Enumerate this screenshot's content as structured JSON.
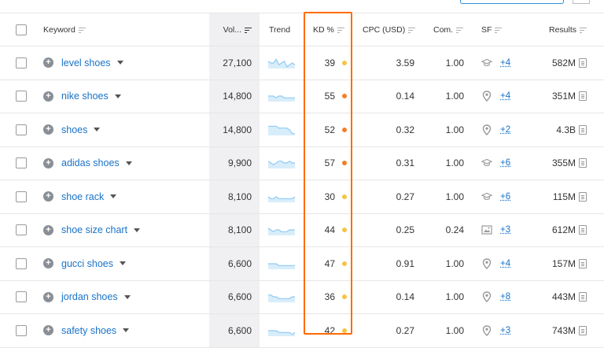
{
  "columns": {
    "keyword": "Keyword",
    "volume": "Vol...",
    "trend": "Trend",
    "kd": "KD %",
    "cpc": "CPC (USD)",
    "com": "Com.",
    "sf": "SF",
    "results": "Results"
  },
  "colors": {
    "kd_easy": "#f6c443",
    "kd_hard": "#f47f28",
    "trend": "#90caf2",
    "highlight_box": "#ff6b00",
    "link": "#1a73c8"
  },
  "rows": [
    {
      "keyword": "level shoes",
      "volume": "27,100",
      "kd": "39",
      "kd_level": "easy",
      "cpc": "3.59",
      "com": "1.00",
      "sf_icon": "graduation-cap-icon",
      "sf_count": "+4",
      "results": "582M",
      "trend": [
        4,
        3,
        3,
        5,
        2,
        3,
        4,
        1,
        2,
        3,
        2
      ]
    },
    {
      "keyword": "nike shoes",
      "volume": "14,800",
      "kd": "55",
      "kd_level": "hard",
      "cpc": "0.14",
      "com": "1.00",
      "sf_icon": "map-pin-icon",
      "sf_count": "+4",
      "results": "351M",
      "trend": [
        3,
        3,
        3,
        2,
        3,
        3,
        2,
        2,
        2,
        2,
        2
      ]
    },
    {
      "keyword": "shoes",
      "volume": "14,800",
      "kd": "52",
      "kd_level": "hard",
      "cpc": "0.32",
      "com": "1.00",
      "sf_icon": "map-pin-icon",
      "sf_count": "+2",
      "results": "4.3B",
      "trend": [
        5,
        5,
        5,
        5,
        4,
        4,
        4,
        4,
        3,
        1,
        1
      ]
    },
    {
      "keyword": "adidas shoes",
      "volume": "9,900",
      "kd": "57",
      "kd_level": "hard",
      "cpc": "0.31",
      "com": "1.00",
      "sf_icon": "graduation-cap-icon",
      "sf_count": "+6",
      "results": "355M",
      "trend": [
        4,
        3,
        2,
        3,
        4,
        4,
        3,
        3,
        4,
        3,
        3
      ]
    },
    {
      "keyword": "shoe rack",
      "volume": "8,100",
      "kd": "30",
      "kd_level": "easy",
      "cpc": "0.27",
      "com": "1.00",
      "sf_icon": "graduation-cap-icon",
      "sf_count": "+6",
      "results": "115M",
      "trend": [
        3,
        2,
        2,
        3,
        2,
        2,
        2,
        2,
        2,
        2,
        3
      ]
    },
    {
      "keyword": "shoe size chart",
      "volume": "8,100",
      "kd": "44",
      "kd_level": "easy",
      "cpc": "0.25",
      "com": "0.24",
      "sf_icon": "image-icon",
      "sf_count": "+3",
      "results": "612M",
      "trend": [
        4,
        3,
        2,
        3,
        3,
        2,
        2,
        2,
        3,
        3,
        3
      ]
    },
    {
      "keyword": "gucci shoes",
      "volume": "6,600",
      "kd": "47",
      "kd_level": "easy",
      "cpc": "0.91",
      "com": "1.00",
      "sf_icon": "map-pin-icon",
      "sf_count": "+4",
      "results": "157M",
      "trend": [
        3,
        3,
        3,
        3,
        2,
        2,
        2,
        2,
        2,
        2,
        2
      ]
    },
    {
      "keyword": "jordan shoes",
      "volume": "6,600",
      "kd": "36",
      "kd_level": "easy",
      "cpc": "0.14",
      "com": "1.00",
      "sf_icon": "map-pin-icon",
      "sf_count": "+8",
      "results": "443M",
      "trend": [
        4,
        4,
        3,
        3,
        2,
        2,
        2,
        2,
        2,
        3,
        3
      ]
    },
    {
      "keyword": "safety shoes",
      "volume": "6,600",
      "kd": "42",
      "kd_level": "easy",
      "cpc": "0.27",
      "com": "1.00",
      "sf_icon": "map-pin-icon",
      "sf_count": "+3",
      "results": "743M",
      "trend": [
        3,
        3,
        3,
        3,
        2,
        2,
        2,
        2,
        2,
        1,
        2
      ]
    }
  ]
}
